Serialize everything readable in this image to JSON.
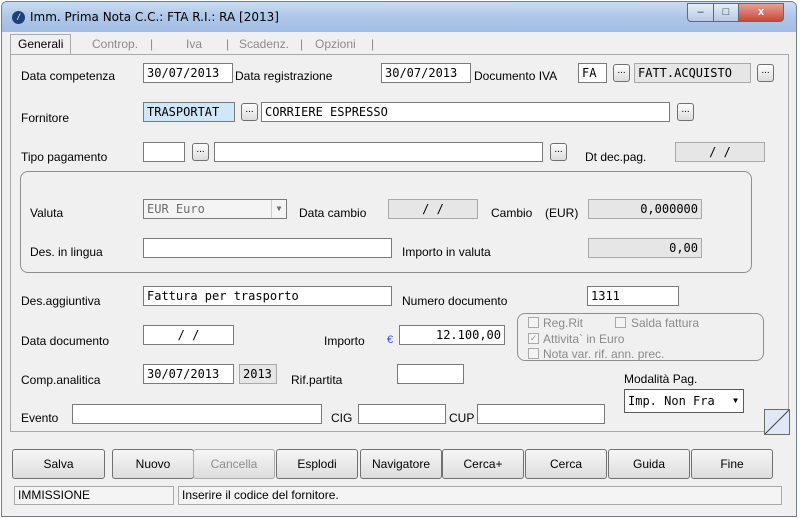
{
  "window": {
    "title": "Imm. Prima Nota C.C.: FTA  R.I.: RA  [2013]",
    "minimize_glyph": "–",
    "maximize_glyph": "□",
    "close_glyph": "x"
  },
  "tabs": [
    "Generali",
    "Controp.",
    "Iva",
    "Scadenz.",
    "Opzioni"
  ],
  "form": {
    "data_competenza": {
      "label": "Data competenza",
      "value": "30/07/2013"
    },
    "data_registrazione": {
      "label": "Data registrazione",
      "value": "30/07/2013"
    },
    "documento_iva": {
      "label": "Documento IVA",
      "code": "FA",
      "desc": "FATT.ACQUISTO"
    },
    "fornitore": {
      "label": "Fornitore",
      "code": "TRASPORTAT",
      "desc": "CORRIERE ESPRESSO"
    },
    "tipo_pagamento": {
      "label": "Tipo pagamento",
      "code": "",
      "desc": ""
    },
    "dt_dec_pag": {
      "label": "Dt dec.pag.",
      "value": "/  /"
    },
    "valuta": {
      "label": "Valuta",
      "value": "EUR Euro"
    },
    "data_cambio": {
      "label": "Data cambio",
      "value": "/  /"
    },
    "cambio": {
      "label": "Cambio",
      "unit": "(EUR)",
      "value": "0,000000"
    },
    "des_in_lingua": {
      "label": "Des. in lingua",
      "value": ""
    },
    "importo_in_valuta": {
      "label": "Importo in valuta",
      "value": "0,00"
    },
    "des_aggiuntiva": {
      "label": "Des.aggiuntiva",
      "value": "Fattura per trasporto"
    },
    "numero_documento": {
      "label": "Numero documento",
      "value": "1311"
    },
    "data_documento": {
      "label": "Data documento",
      "value": "/  /"
    },
    "importo": {
      "label": "Importo",
      "currency_symbol": "€",
      "value": "12.100,00"
    },
    "checks": {
      "reg_rit": "Reg.Rit",
      "salda_fattura": "Salda fattura",
      "attivita_in_euro": "Attivita` in Euro",
      "nota_var": "Nota var. rif. ann. prec."
    },
    "comp_analitica": {
      "label": "Comp.analitica",
      "date": "30/07/2013",
      "year": "2013"
    },
    "rif_partita": {
      "label": "Rif.partita",
      "value": ""
    },
    "modalita_pag": {
      "label": "Modalità Pag.",
      "value": "Imp. Non Fra"
    },
    "evento": {
      "label": "Evento",
      "value": ""
    },
    "cig": {
      "label": "CIG",
      "value": ""
    },
    "cup": {
      "label": "CUP",
      "value": ""
    }
  },
  "dots_glyph": "...",
  "buttons": {
    "salva": "Salva",
    "nuovo": "Nuovo",
    "cancella": "Cancella",
    "esplodi": "Esplodi",
    "navigatore": "Navigatore",
    "cerca_plus": "Cerca+",
    "cerca": "Cerca",
    "guida": "Guida",
    "fine": "Fine"
  },
  "status": {
    "mode": "IMMISSIONE",
    "message": "Inserire il codice del fornitore."
  }
}
